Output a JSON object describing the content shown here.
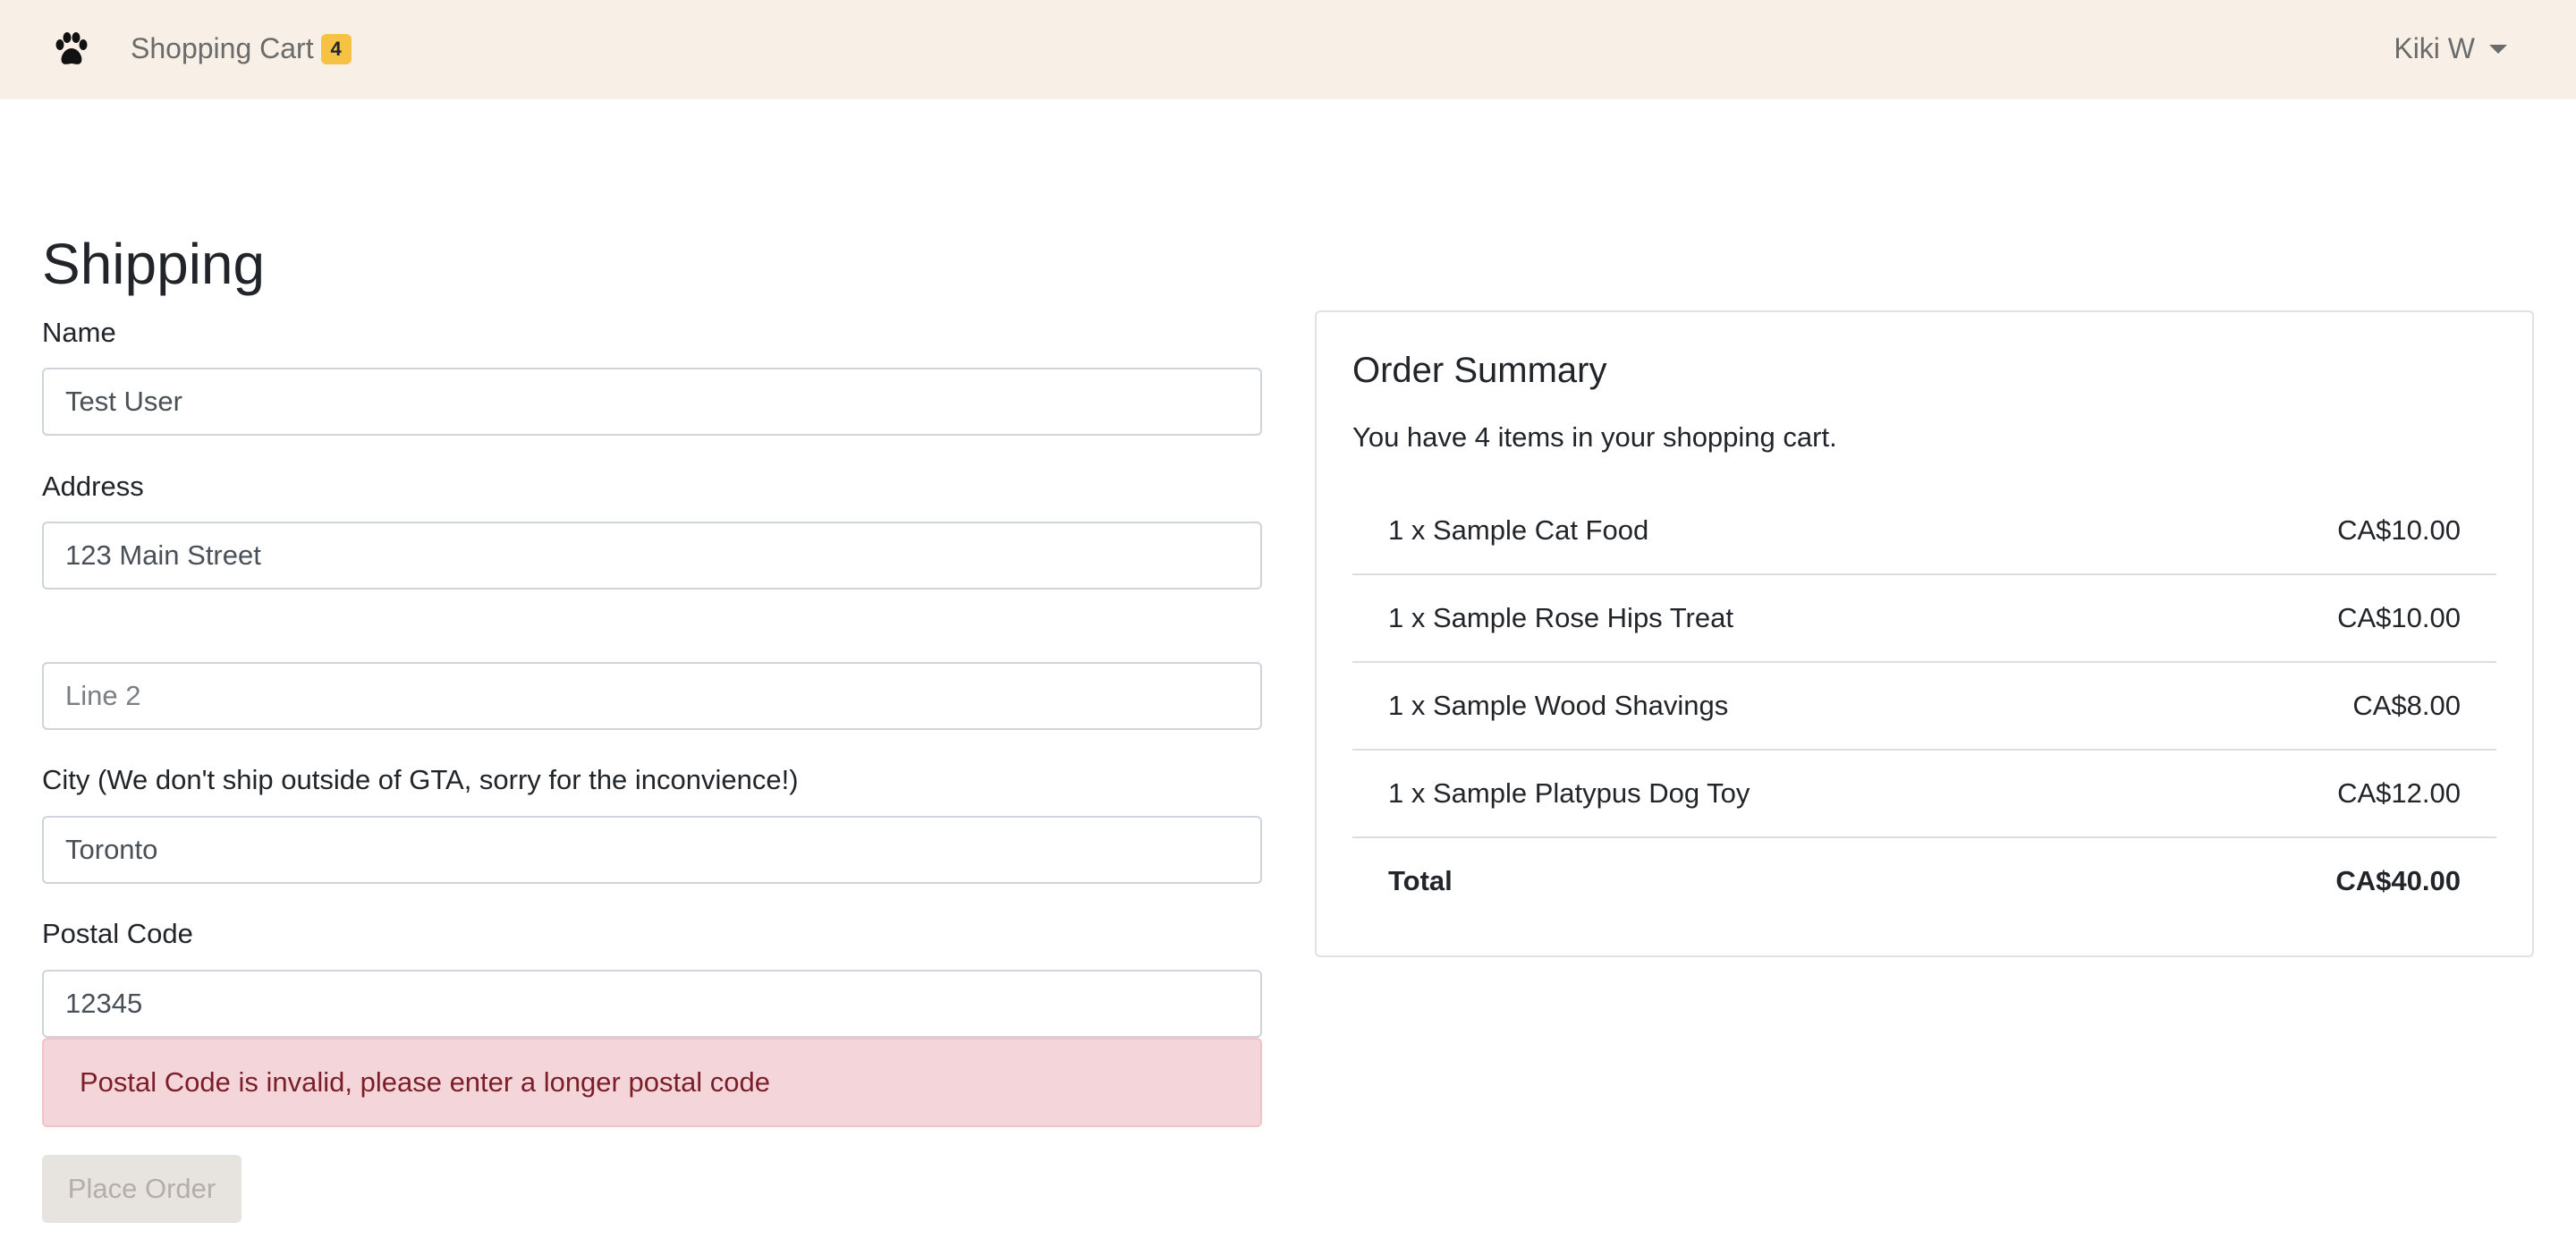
{
  "navbar": {
    "brand_icon": "paw-icon",
    "cart_label": "Shopping Cart",
    "cart_count": "4",
    "badge_color": "#f5c244",
    "user_name": "Kiki W",
    "background": "#f8efe6"
  },
  "page": {
    "title": "Shipping"
  },
  "form": {
    "name": {
      "label": "Name",
      "value": "Test User",
      "placeholder": ""
    },
    "address": {
      "label": "Address",
      "value": "123 Main Street",
      "placeholder": ""
    },
    "line2": {
      "value": "",
      "placeholder": "Line 2"
    },
    "city": {
      "label": "City (We don't ship outside of GTA, sorry for the inconvience!)",
      "value": "Toronto",
      "placeholder": ""
    },
    "postal": {
      "label": "Postal Code",
      "value": "12345",
      "placeholder": ""
    },
    "error": "Postal Code is invalid, please enter a longer postal code",
    "error_color": "#f4d6da",
    "submit_label": "Place Order",
    "submit_disabled": true
  },
  "summary": {
    "title": "Order Summary",
    "text": "You have 4 items in your shopping cart.",
    "items": [
      {
        "name": "1 x Sample Cat Food",
        "price": "CA$10.00"
      },
      {
        "name": "1 x Sample Rose Hips Treat",
        "price": "CA$10.00"
      },
      {
        "name": "1 x Sample Wood Shavings",
        "price": "CA$8.00"
      },
      {
        "name": "1 x Sample Platypus Dog Toy",
        "price": "CA$12.00"
      }
    ],
    "total_label": "Total",
    "total_value": "CA$40.00"
  }
}
